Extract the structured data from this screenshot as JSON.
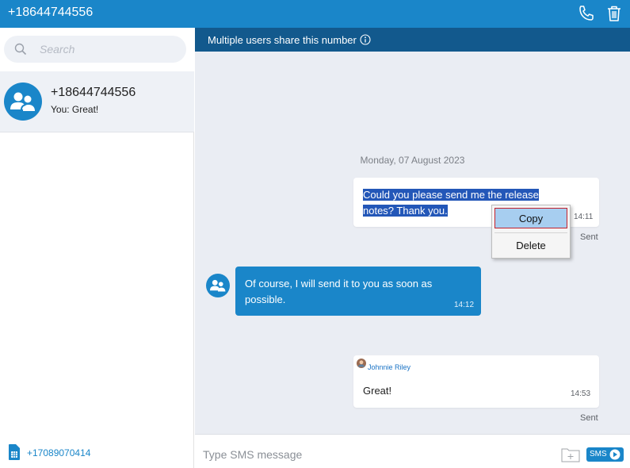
{
  "header": {
    "title": "+18644744556",
    "call_icon": "phone-icon",
    "delete_icon": "trash-icon"
  },
  "sidebar": {
    "search_placeholder": "Search",
    "conversation": {
      "name": "+18644744556",
      "preview": "You: Great!",
      "avatar_icon": "group-avatar-icon"
    },
    "footer_number": "+17089070414",
    "footer_icon": "sim-card-icon"
  },
  "chat": {
    "banner": "Multiple users share this number",
    "banner_icon": "info-icon",
    "date_separator": "Monday, 07 August 2023",
    "messages": [
      {
        "direction": "outgoing",
        "text_line1": "Could you please send me the release",
        "text_line2": "notes? Thank you.",
        "time": "14:11",
        "status": "Sent",
        "selected": true
      },
      {
        "direction": "incoming",
        "text_line1": "Of course, I will send it to you as soon as",
        "text_line2": "possible.",
        "time": "14:12"
      },
      {
        "direction": "outgoing",
        "author": "Johnnie Riley",
        "text": "Great!",
        "time": "14:53",
        "status": "Sent"
      }
    ],
    "context_menu": {
      "items": [
        "Copy",
        "Delete"
      ],
      "highlighted": "Copy"
    }
  },
  "composer": {
    "placeholder": "Type SMS message",
    "attach_icon": "attach-file-icon",
    "send_label": "SMS",
    "send_icon": "send-arrow-icon"
  },
  "colors": {
    "primary": "#1a86c9",
    "banner": "#12598d",
    "chat_bg": "#eaedf3",
    "selection": "#2357b8"
  }
}
